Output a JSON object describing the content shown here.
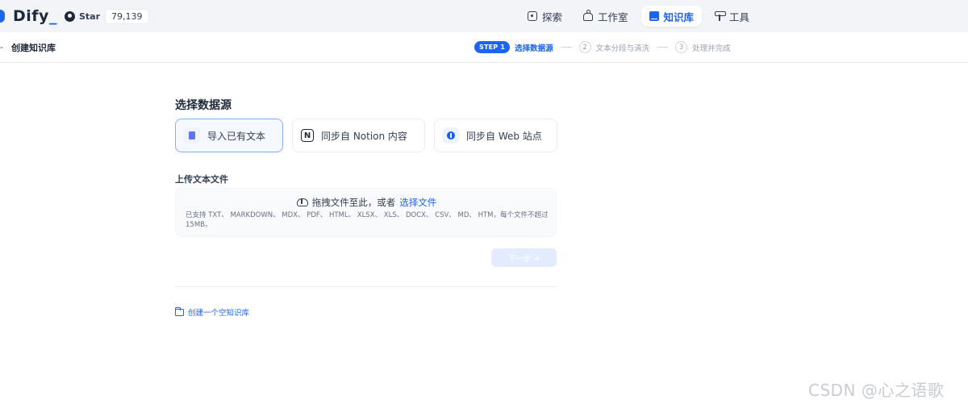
{
  "app": {
    "logo_text": "Dify"
  },
  "github": {
    "star_label": "Star",
    "star_count": "79,139"
  },
  "nav": {
    "items": [
      {
        "label": "探索",
        "icon": "explore-icon"
      },
      {
        "label": "工作室",
        "icon": "studio-icon"
      },
      {
        "label": "知识库",
        "icon": "knowledge-icon",
        "active": true
      },
      {
        "label": "工具",
        "icon": "tools-icon"
      }
    ]
  },
  "subheader": {
    "back_glyph": "-",
    "title": "创建知识库",
    "steps": [
      {
        "badge": "STEP 1",
        "label": "选择数据源",
        "active": true
      },
      {
        "num": "2",
        "label": "文本分段与清洗"
      },
      {
        "num": "3",
        "label": "处理并完成"
      }
    ]
  },
  "main": {
    "section_title": "选择数据源",
    "sources": [
      {
        "label": "导入已有文本",
        "icon": "file-icon",
        "active": true
      },
      {
        "label": "同步自 Notion 内容",
        "icon": "notion-icon",
        "icon_glyph": "N"
      },
      {
        "label": "同步自 Web 站点",
        "icon": "web-icon"
      }
    ],
    "upload": {
      "title": "上传文本文件",
      "drag_text": "拖拽文件至此，或者",
      "select_link": "选择文件",
      "hint": "已支持 TXT、 MARKDOWN、 MDX、 PDF、 HTML、 XLSX、 XLS、 DOCX、 CSV、 MD、 HTM，每个文件不超过 15MB。"
    },
    "next_button": "下一步 ➔",
    "create_empty": "创建一个空知识库"
  },
  "watermark": "CSDN @心之语歌",
  "colors": {
    "accent": "#1c64f2",
    "topbar_bg": "#f2f4f7"
  }
}
